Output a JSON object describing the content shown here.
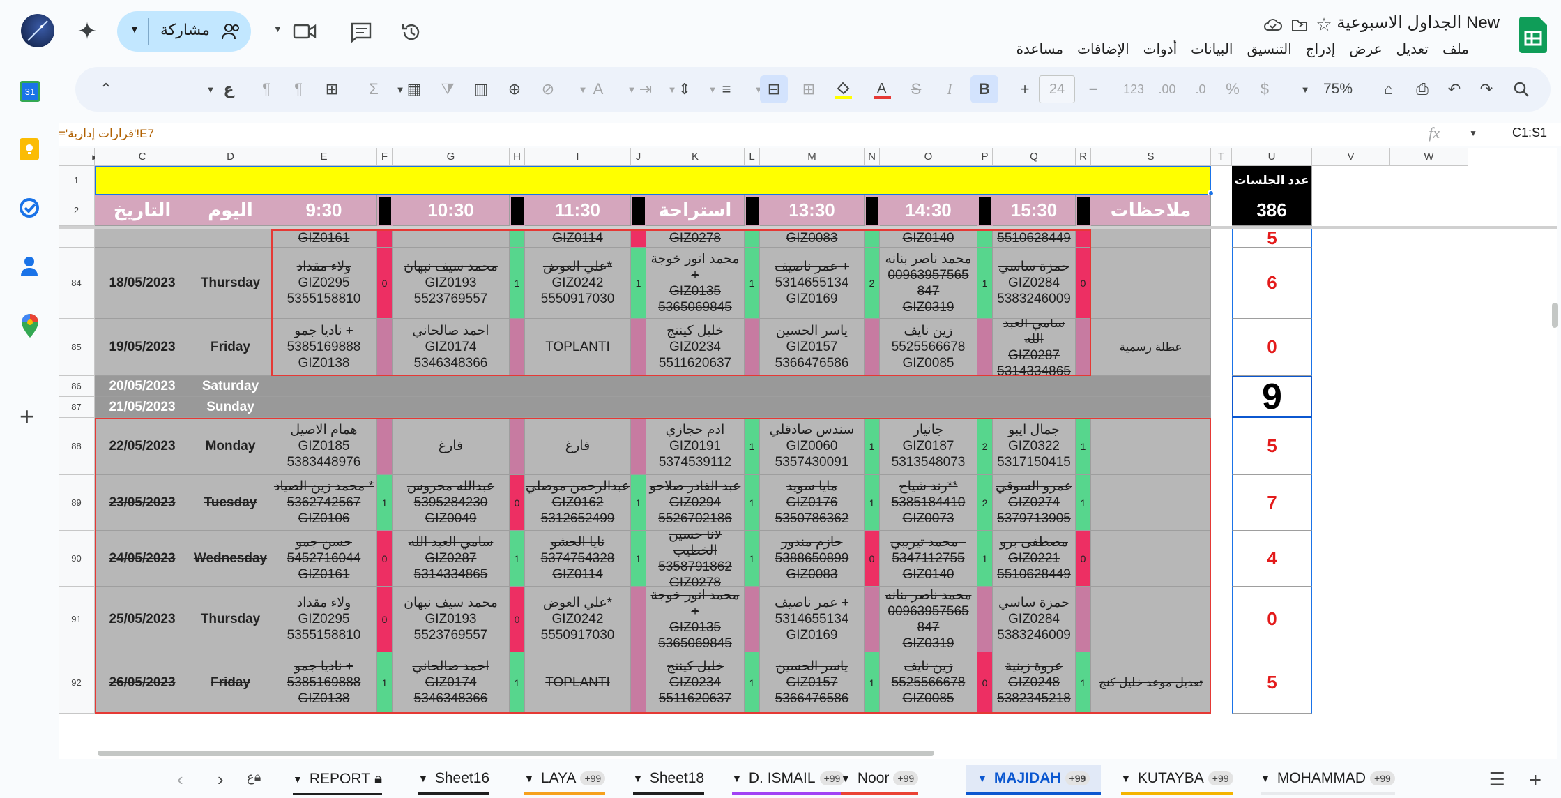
{
  "doc": {
    "title": "الجداول الاسبوعية New",
    "share_label": "مشاركة"
  },
  "menu": [
    "ملف",
    "تعديل",
    "عرض",
    "إدراج",
    "التنسيق",
    "البيانات",
    "أدوات",
    "الإضافات",
    "مساعدة"
  ],
  "toolbar": {
    "zoom": "75%",
    "font_size": "24",
    "currency": "$",
    "percent": "%",
    "dec_down": ".0",
    "dec_up": ".00",
    "number": "123",
    "input_mode": "ع"
  },
  "formula": {
    "namebox": "C1:S1",
    "fx": "fx",
    "content": "='قرارات إدارية'!E7"
  },
  "columns": [
    "C",
    "D",
    "E",
    "F",
    "G",
    "H",
    "I",
    "J",
    "K",
    "L",
    "M",
    "N",
    "O",
    "P",
    "Q",
    "R",
    "S",
    "T",
    "U",
    "V",
    "W"
  ],
  "header": {
    "date": "التاريخ",
    "day": "اليوم",
    "t930": "9:30",
    "t1030": "10:30",
    "t1130": "11:30",
    "break": "استراحة",
    "t1330": "13:30",
    "t1430": "14:30",
    "t1530": "15:30",
    "notes": "ملاحظات",
    "sessions_label": "عدد الجلسات",
    "sessions_total": "386"
  },
  "rows": [
    {
      "num": "",
      "date": "",
      "day": "",
      "e": "GIZ0161",
      "g": "",
      "i": "GIZ0114",
      "k": "GIZ0278",
      "m": "GIZ0083",
      "o": "GIZ0140",
      "q": "5510628449",
      "s": "",
      "u": "5",
      "f": "",
      "h": "",
      "j": "",
      "l": "",
      "n": "",
      "p": "",
      "r": ""
    },
    {
      "num": "84",
      "date": "18/05/2023",
      "day": "Thursday",
      "e": "ولاء مقداد\nGIZ0295\n5355158810",
      "f": "0",
      "g": "محمد سيف نبهان\nGIZ0193\n5523769557",
      "h": "1",
      "i": "علي العوض*\nGIZ0242\n5550917030",
      "j": "1",
      "k": "محمد انور خوجة +\nGIZ0135\n5365069845",
      "l": "1",
      "m": "عمر ناصيف +\n5314655134\nGIZ0169",
      "n": "2",
      "o": "محمد ناصر بنانه\n00963957565\n847\nGIZ0319",
      "p": "1",
      "q": "حمزة ساسي\nGIZ0284\n5383246009",
      "r": "0",
      "s": "",
      "u": "6"
    },
    {
      "num": "85",
      "date": "19/05/2023",
      "day": "Friday",
      "e": "ناديا جمو +\n5385169888\nGIZ0138",
      "f": "",
      "g": "احمد صالحاني\nGIZ0174\n5346348366",
      "h": "",
      "i": "TOPLANTI",
      "j": "",
      "k": "خليل كينتج\nGIZ0234\n5511620637",
      "l": "",
      "m": "ياسر الحسين\nGIZ0157\n5366476586",
      "n": "",
      "o": "زين نايف\n5525566678\nGIZ0085",
      "p": "",
      "q": "سامي العبد الله\nGIZ0287\n5314334865",
      "r": "",
      "s": "عطلة رسمية",
      "u": "0"
    },
    {
      "num": "86",
      "date": "20/05/2023",
      "day": "Saturday",
      "u": "9"
    },
    {
      "num": "87",
      "date": "21/05/2023",
      "day": "Sunday",
      "u": ""
    },
    {
      "num": "88",
      "date": "22/05/2023",
      "day": "Monday",
      "e": "همام الاصيل\nGIZ0185\n5383448976",
      "f": "",
      "g": "فارغ",
      "h": "",
      "i": "فارغ",
      "j": "",
      "k": "ادم حجازي\nGIZ0191\n5374539112",
      "l": "1",
      "m": "سندس صادقلي\nGIZ0060\n5357430091",
      "n": "1",
      "o": "جانيار\nGIZ0187\n5313548073",
      "p": "2",
      "q": "جمال ايبو\nGIZ0322\n5317150415",
      "r": "1",
      "s": "",
      "u": "5"
    },
    {
      "num": "89",
      "date": "23/05/2023",
      "day": "Tuesday",
      "e": "محمد زين الصياد *\n5362742567\nGIZ0106",
      "f": "1",
      "g": "عبدالله محروس\n5395284230\nGIZ0049",
      "h": "0",
      "i": "عبدالرحمن موصلي\nGIZ0162\n5312652499",
      "j": "1",
      "k": "عبد القادر صلاحو\nGIZ0294\n5526702186",
      "l": "1",
      "m": "مايا سويد\nGIZ0176\n5350786362",
      "n": "1",
      "o": "رند شياح**\n5385184410\nGIZ0073",
      "p": "2",
      "q": "عمرو السوقي\nGIZ0274\n5379713905",
      "r": "1",
      "s": "",
      "u": "7"
    },
    {
      "num": "90",
      "date": "24/05/2023",
      "day": "Wednesday",
      "e": "حسن جمو\n5452716044\nGIZ0161",
      "f": "0",
      "g": "سامي العبد الله\nGIZ0287\n5314334865",
      "h": "1",
      "i": "نايا الحشو\n5374754328\nGIZ0114",
      "j": "1",
      "k": "لانا حسين الخطيب\n5358791862\nGIZ0278",
      "l": "1",
      "m": "حازم مندور\n5388650899\nGIZ0083",
      "n": "0",
      "o": "محمد تيريبي -\n5347112755\nGIZ0140",
      "p": "1",
      "q": "مصطفى برو\nGIZ0221\n5510628449",
      "r": "0",
      "s": "",
      "u": "4"
    },
    {
      "num": "91",
      "date": "25/05/2023",
      "day": "Thursday",
      "e": "ولاء مقداد\nGIZ0295\n5355158810",
      "f": "0",
      "g": "محمد سيف نبهان\nGIZ0193\n5523769557",
      "h": "0",
      "i": "علي العوض*\nGIZ0242\n5550917030",
      "j": "",
      "k": "محمد انور خوجة +\nGIZ0135\n5365069845",
      "l": "",
      "m": "عمر ناصيف +\n5314655134\nGIZ0169",
      "n": "",
      "o": "محمد ناصر بنانه\n00963957565\n847\nGIZ0319",
      "p": "",
      "q": "حمزة ساسي\nGIZ0284\n5383246009",
      "r": "",
      "s": "",
      "u": "0"
    },
    {
      "num": "92",
      "date": "26/05/2023",
      "day": "Friday",
      "e": "ناديا جمو +\n5385169888\nGIZ0138",
      "f": "1",
      "g": "احمد صالحاني\nGIZ0174\n5346348366",
      "h": "1",
      "i": "TOPLANTI",
      "j": "",
      "k": "خليل كينتج\nGIZ0234\n5511620637",
      "l": "1",
      "m": "ياسر الحسين\nGIZ0157\n5366476586",
      "n": "1",
      "o": "زين نايف\n5525566678\nGIZ0085",
      "p": "0",
      "q": "عروة زينية\nGIZ0248\n5382345218",
      "r": "1",
      "s": "تعديل موعد خليل كنج",
      "u": "5"
    }
  ],
  "tabs": [
    {
      "label": "REPORT",
      "badge": "",
      "lock": true
    },
    {
      "label": "Sheet16",
      "badge": ""
    },
    {
      "label": "LAYA",
      "badge": "+99"
    },
    {
      "label": "Sheet18",
      "badge": ""
    },
    {
      "label": "D. ISMAIL",
      "badge": "+99"
    },
    {
      "label": "Noor",
      "badge": "+99"
    },
    {
      "label": "MAJIDAH",
      "badge": "+99",
      "active": true
    },
    {
      "label": "KUTAYBA",
      "badge": "+99"
    },
    {
      "label": "MOHAMMAD",
      "badge": "+99"
    }
  ],
  "colors": {
    "accent": "#0b57d0",
    "green": "#57d68d",
    "red": "#ed2f63",
    "pink": "#c77ba1",
    "yellow": "#ffff00",
    "header_pink": "#d5a6bd"
  }
}
